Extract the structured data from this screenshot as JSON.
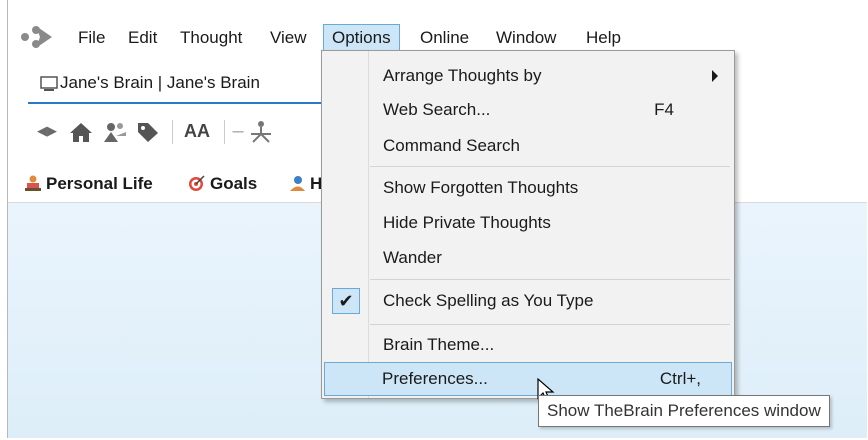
{
  "menubar": {
    "items": [
      "File",
      "Edit",
      "Thought",
      "View",
      "Options",
      "Online",
      "Window",
      "Help"
    ],
    "active": "Options"
  },
  "tab": {
    "label": "Jane's Brain | Jane's Brain"
  },
  "toolbar": {
    "icons": [
      "back-forward-icon",
      "home-icon",
      "outline-icon",
      "tag-icon",
      "font-size-icon",
      "layout-icon"
    ],
    "font_label": "AA"
  },
  "pins": {
    "items": [
      {
        "label": "Personal Life",
        "icon": "person-desk-icon"
      },
      {
        "label": "Goals",
        "icon": "target-icon"
      },
      {
        "label": "H",
        "icon": "person-icon"
      }
    ]
  },
  "options_menu": {
    "items": [
      {
        "label": "Arrange Thoughts by",
        "shortcut": "",
        "submenu": true
      },
      {
        "label": "Web Search...",
        "shortcut": "F4"
      },
      {
        "label": "Command Search",
        "shortcut": ""
      },
      {
        "label": "Show Forgotten Thoughts",
        "shortcut": ""
      },
      {
        "label": "Hide Private Thoughts",
        "shortcut": ""
      },
      {
        "label": "Wander",
        "shortcut": ""
      },
      {
        "label": "Check Spelling as You Type",
        "shortcut": "",
        "checked": true
      },
      {
        "label": "Brain Theme...",
        "shortcut": ""
      },
      {
        "label": "Preferences...",
        "shortcut": "Ctrl+,",
        "highlighted": true
      }
    ]
  },
  "tooltip": {
    "text": "Show TheBrain Preferences window"
  },
  "colors": {
    "accent": "#2b78c5",
    "highlight": "#cde6f7",
    "highlight_border": "#6aa9d8",
    "canvas_bg": "#e4f1fb"
  }
}
